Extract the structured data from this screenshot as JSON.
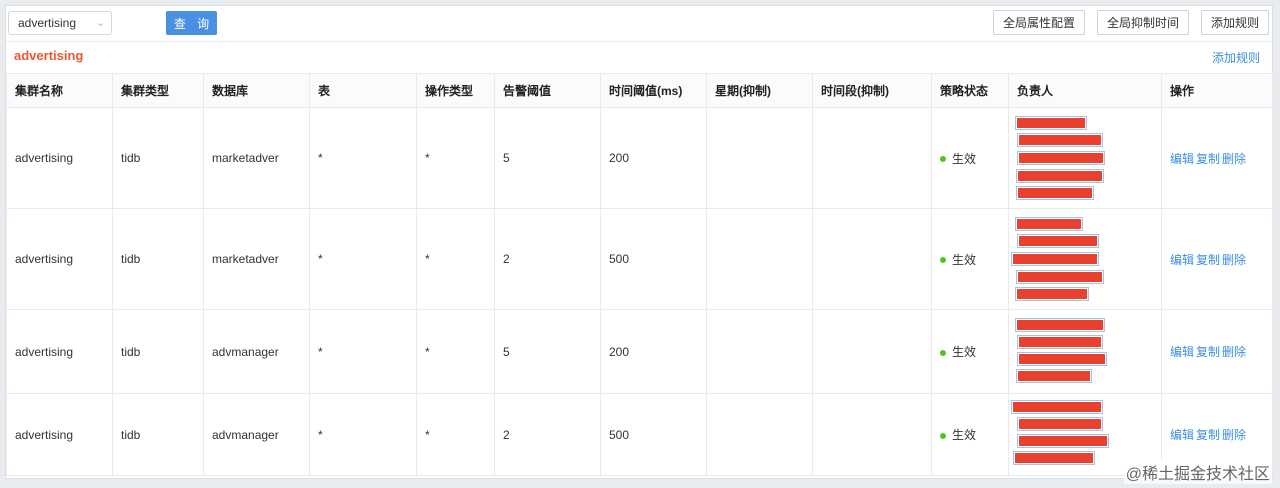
{
  "filter": {
    "selected": "advertising",
    "query_label": "查 询"
  },
  "toolbar": {
    "global_config": "全局属性配置",
    "global_suppress": "全局抑制时间",
    "add_rule": "添加规则"
  },
  "section": {
    "title": "advertising",
    "add_link": "添加规则"
  },
  "table": {
    "headers": [
      "集群名称",
      "集群类型",
      "数据库",
      "表",
      "操作类型",
      "告警阈值",
      "时间阈值(ms)",
      "星期(抑制)",
      "时间段(抑制)",
      "策略状态",
      "负责人",
      "操作"
    ],
    "rows": [
      {
        "cluster": "advertising",
        "type": "tidb",
        "db": "marketadver",
        "table": "*",
        "op": "*",
        "alert": "5",
        "time": "200",
        "week": "",
        "period": "",
        "status": "生效"
      },
      {
        "cluster": "advertising",
        "type": "tidb",
        "db": "marketadver",
        "table": "*",
        "op": "*",
        "alert": "2",
        "time": "500",
        "week": "",
        "period": "",
        "status": "生效"
      },
      {
        "cluster": "advertising",
        "type": "tidb",
        "db": "advmanager",
        "table": "*",
        "op": "*",
        "alert": "5",
        "time": "200",
        "week": "",
        "period": "",
        "status": "生效"
      },
      {
        "cluster": "advertising",
        "type": "tidb",
        "db": "advmanager",
        "table": "*",
        "op": "*",
        "alert": "2",
        "time": "500",
        "week": "",
        "period": "",
        "status": "生效"
      }
    ],
    "actions": {
      "edit": "编辑",
      "copy": "复制",
      "delete": "删除"
    }
  },
  "watermark": "@稀土掘金技术社区",
  "colors": {
    "accent": "#4a90e2",
    "section_title": "#e8592f",
    "link": "#3a8ee6",
    "status_active": "#52c41a",
    "redaction": "#e8412f"
  }
}
